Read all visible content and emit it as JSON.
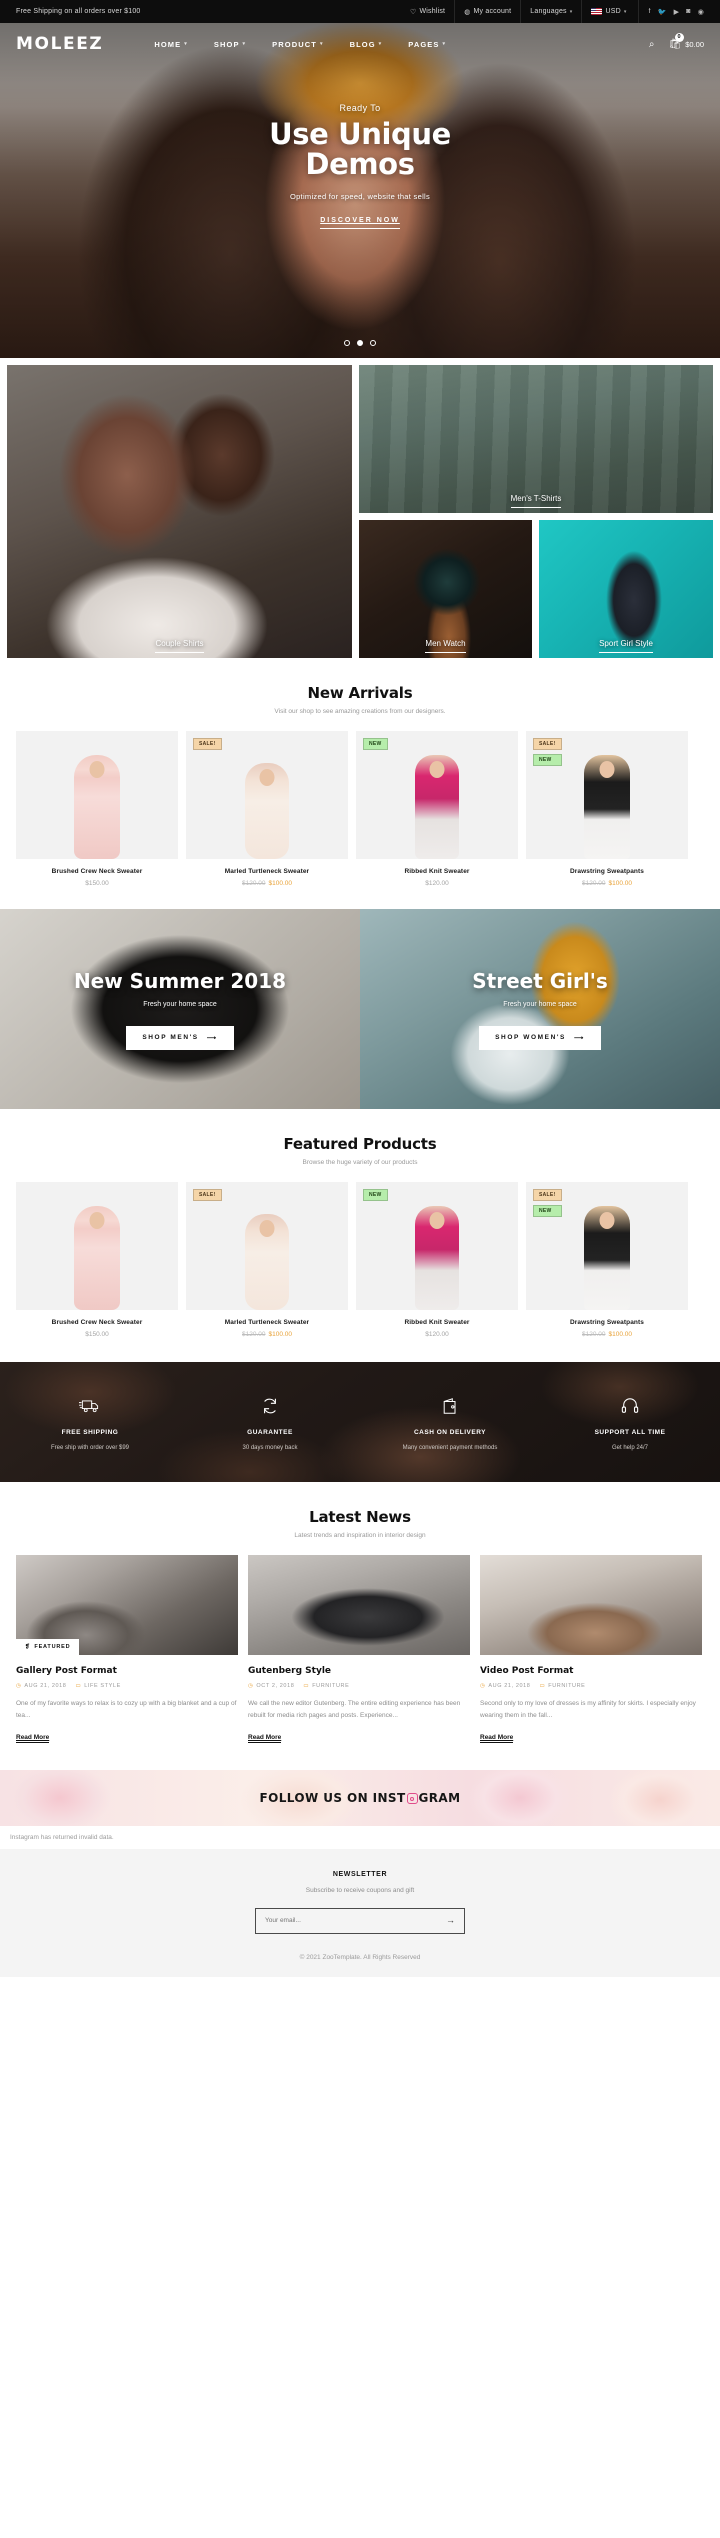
{
  "topbar": {
    "promo": "Free Shipping on all orders over $100",
    "wishlist": "Wishlist",
    "account": "My account",
    "languages": "Languages",
    "currency": "USD",
    "socials": [
      "facebook-icon",
      "twitter-icon",
      "youtube-icon",
      "instagram-icon",
      "pinterest-icon"
    ]
  },
  "header": {
    "logo": "MOLEEZ",
    "menu": [
      "HOME",
      "SHOP",
      "PRODUCT",
      "BLOG",
      "PAGES"
    ],
    "cart_count": "0",
    "cart_total": "$0.00"
  },
  "hero": {
    "kicker": "Ready To",
    "title_line1": "Use Unique",
    "title_line2": "Demos",
    "subtitle": "Optimized for speed, website that sells",
    "cta": "DISCOVER NOW",
    "slides": 3,
    "active_slide": 2
  },
  "categories": [
    {
      "label": "Couple Shirts"
    },
    {
      "label": "Men's T-Shirts"
    },
    {
      "label": "Men Watch"
    },
    {
      "label": "Sport Girl Style"
    }
  ],
  "new_arrivals": {
    "title": "New Arrivals",
    "subtitle": "Visit our shop to see amazing creations from our designers."
  },
  "featured": {
    "title": "Featured Products",
    "subtitle": "Browse the huge variety of our products"
  },
  "products": [
    {
      "name": "Brushed Crew Neck Sweater",
      "price": "$150.00",
      "old": "",
      "sale": "",
      "badges": []
    },
    {
      "name": "Marled Turtleneck Sweater",
      "price": "",
      "old": "$120.00",
      "sale": "$100.00",
      "badges": [
        "SALE!"
      ]
    },
    {
      "name": "Ribbed Knit Sweater",
      "price": "$120.00",
      "old": "",
      "sale": "",
      "badges": [
        "NEW"
      ]
    },
    {
      "name": "Drawstring Sweatpants",
      "price": "",
      "old": "$120.00",
      "sale": "$100.00",
      "badges": [
        "SALE!",
        "NEW"
      ]
    }
  ],
  "promos": [
    {
      "title": "New Summer 2018",
      "subtitle": "Fresh your home space",
      "button": "SHOP MEN'S"
    },
    {
      "title": "Street Girl's",
      "subtitle": "Fresh your home space",
      "button": "SHOP WOMEN'S"
    }
  ],
  "services": [
    {
      "icon": "truck-icon",
      "title": "FREE SHIPPING",
      "text": "Free ship with order over $99"
    },
    {
      "icon": "refresh-icon",
      "title": "GUARANTEE",
      "text": "30 days money back"
    },
    {
      "icon": "wallet-icon",
      "title": "CASH ON DELIVERY",
      "text": "Many convenient payment methods"
    },
    {
      "icon": "headset-icon",
      "title": "SUPPORT ALL TIME",
      "text": "Get help 24/7"
    }
  ],
  "news": {
    "title": "Latest News",
    "subtitle": "Latest trends and inspiration in interior design"
  },
  "posts": [
    {
      "featured_label": "FEATURED",
      "title": "Gallery Post Format",
      "date": "AUG 21, 2018",
      "category": "LIFE STYLE",
      "excerpt": "One of my favorite ways to relax is to cozy up with a big blanket and a cup of tea...",
      "read_more": "Read More"
    },
    {
      "title": "Gutenberg Style",
      "date": "OCT 2, 2018",
      "category": "FURNITURE",
      "excerpt": "We call the new editor Gutenberg. The entire editing experience has been rebuilt for media rich pages and posts. Experience...",
      "read_more": "Read More"
    },
    {
      "title": "Video Post Format",
      "date": "AUG 21, 2018",
      "category": "FURNITURE",
      "excerpt": "Second only to my love of dresses is my affinity for skirts. I especially enjoy wearing them in the fall...",
      "read_more": "Read More"
    }
  ],
  "instagram": {
    "heading_before": "FOLLOW US ON INST",
    "heading_after": "GRAM",
    "error": "Instagram has returned invalid data."
  },
  "newsletter": {
    "title": "NEWSLETTER",
    "subtitle": "Subscribe to receive coupons and gift",
    "placeholder": "Your email...",
    "submit": "→"
  },
  "footer": {
    "copyright": "© 2021 ZooTemplate. All Rights Reserved"
  },
  "colors": {
    "accent": "#e8a33a",
    "dark": "#0d0d0d",
    "sale_badge": "#f5d5a8",
    "new_badge": "#b6edab"
  }
}
